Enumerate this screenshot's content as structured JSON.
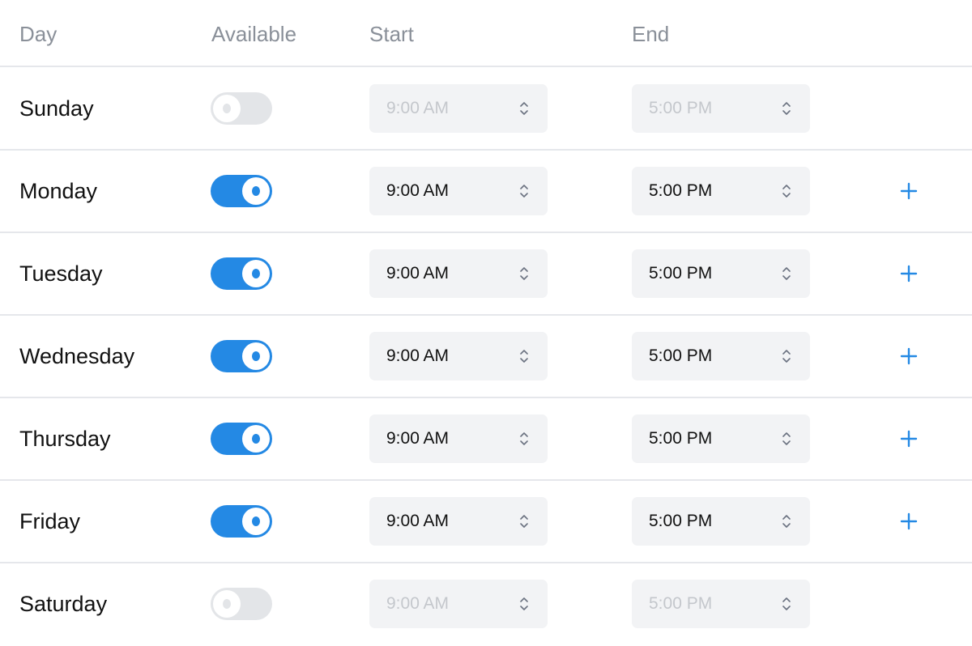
{
  "header": {
    "day": "Day",
    "available": "Available",
    "start": "Start",
    "end": "End"
  },
  "colors": {
    "accent": "#2489e4",
    "toggle_off": "#e3e5e8",
    "select_bg": "#f2f3f5",
    "header_text": "#8a9099",
    "disabled_text": "#c4c7cc"
  },
  "days": [
    {
      "name": "Sunday",
      "available": false,
      "start": "9:00 AM",
      "end": "5:00 PM",
      "show_add": false
    },
    {
      "name": "Monday",
      "available": true,
      "start": "9:00 AM",
      "end": "5:00 PM",
      "show_add": true
    },
    {
      "name": "Tuesday",
      "available": true,
      "start": "9:00 AM",
      "end": "5:00 PM",
      "show_add": true
    },
    {
      "name": "Wednesday",
      "available": true,
      "start": "9:00 AM",
      "end": "5:00 PM",
      "show_add": true
    },
    {
      "name": "Thursday",
      "available": true,
      "start": "9:00 AM",
      "end": "5:00 PM",
      "show_add": true
    },
    {
      "name": "Friday",
      "available": true,
      "start": "9:00 AM",
      "end": "5:00 PM",
      "show_add": true
    },
    {
      "name": "Saturday",
      "available": false,
      "start": "9:00 AM",
      "end": "5:00 PM",
      "show_add": false
    }
  ],
  "icons": {
    "select": "chevron-up-down-icon",
    "add": "plus-icon"
  }
}
